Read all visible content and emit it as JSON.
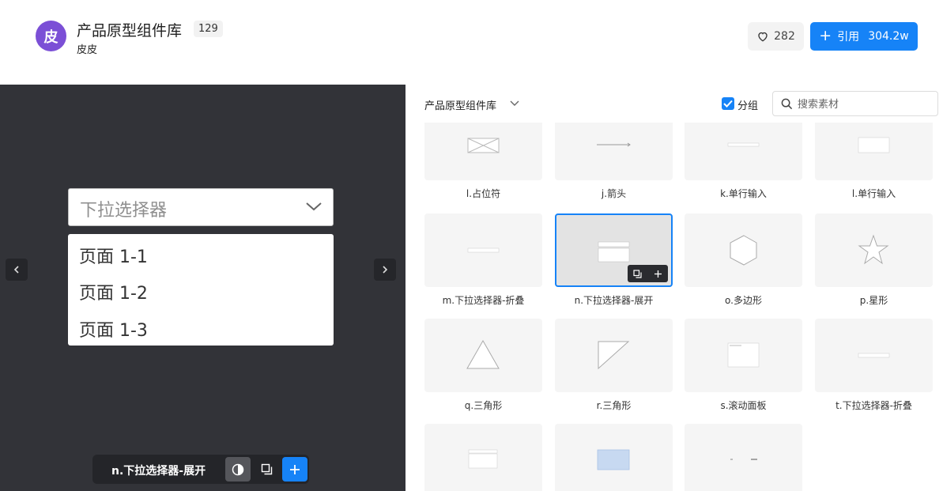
{
  "header": {
    "avatar_text": "皮",
    "title": "产品原型组件库",
    "count": "129",
    "author": "皮皮",
    "likes": "282",
    "cite_label": "引用",
    "cite_count": "304.2w",
    "accent": "#1683f7"
  },
  "preview": {
    "dropdown_placeholder": "下拉选择器",
    "options": [
      "页面 1-1",
      "页面 1-2",
      "页面 1-3"
    ],
    "current_name": "n.下拉选择器-展开",
    "background": "#323338"
  },
  "panel": {
    "library_name": "产品原型组件库",
    "group_label": "分组",
    "group_checked": true,
    "search_placeholder": "搜索素材"
  },
  "items": [
    {
      "label": "l.占位符",
      "icon": "placeholder-thumb"
    },
    {
      "label": "j.箭头",
      "icon": "arrow-thumb"
    },
    {
      "label": "k.单行输入",
      "icon": "input-thumb"
    },
    {
      "label": "l.单行输入",
      "icon": "input-thumb"
    },
    {
      "label": "m.下拉选择器-折叠",
      "icon": "dropdown-collapsed-thumb"
    },
    {
      "label": "n.下拉选择器-展开",
      "icon": "dropdown-expanded-thumb",
      "selected": true
    },
    {
      "label": "o.多边形",
      "icon": "hexagon-thumb"
    },
    {
      "label": "p.星形",
      "icon": "star-thumb"
    },
    {
      "label": "q.三角形",
      "icon": "triangle-thumb"
    },
    {
      "label": "r.三角形",
      "icon": "right-triangle-thumb"
    },
    {
      "label": "s.滚动面板",
      "icon": "scroll-panel-thumb"
    },
    {
      "label": "t.下拉选择器-折叠",
      "icon": "dropdown-collapsed-thumb"
    },
    {
      "label": "",
      "icon": "dropdown-expanded-thumb"
    },
    {
      "label": "",
      "icon": "blue-rect-thumb"
    },
    {
      "label": "",
      "icon": "arrow-small-thumb"
    }
  ]
}
